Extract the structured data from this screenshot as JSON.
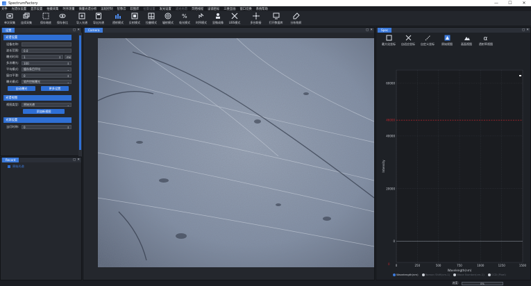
{
  "window": {
    "title": "SpectrumFactory",
    "minimize": "—",
    "maximize": "☐",
    "close": "✕"
  },
  "menu": [
    {
      "label": "文件",
      "dim": false
    },
    {
      "label": "光谱仪设置",
      "dim": false
    },
    {
      "label": "显示设置",
      "dim": false
    },
    {
      "label": "拍摄采集",
      "dim": false
    },
    {
      "label": "时序测量",
      "dim": false
    },
    {
      "label": "微量光谱分析",
      "dim": false
    },
    {
      "label": "运程控制",
      "dim": false
    },
    {
      "label": "智像云",
      "dim": false
    },
    {
      "label": "软图库",
      "dim": false
    },
    {
      "label": "拉曼设置",
      "dim": true
    },
    {
      "label": "发光设置",
      "dim": false
    },
    {
      "label": "滤光光谱",
      "dim": true
    },
    {
      "label": "荧晒线程",
      "dim": false
    },
    {
      "label": "宙铺密标",
      "dim": false
    },
    {
      "label": "三维显画",
      "dim": false
    },
    {
      "label": "窗口切换",
      "dim": false
    },
    {
      "label": "系统帮助",
      "dim": false
    }
  ],
  "toolbar": [
    {
      "label": "单次采集",
      "icon": "single-capture-icon",
      "wide": false
    },
    {
      "label": "连续采集",
      "icon": "continuous-capture-icon",
      "wide": false
    },
    {
      "sep": true
    },
    {
      "label": "保存暗底",
      "icon": "save-dark-icon",
      "wide": false
    },
    {
      "label": "保存参比",
      "icon": "save-reference-icon",
      "wide": false
    },
    {
      "sep": true
    },
    {
      "label": "导入光谱",
      "icon": "import-spectrum-icon",
      "wide": false
    },
    {
      "label": "导出光谱",
      "icon": "export-spectrum-icon",
      "wide": false
    },
    {
      "sep": true
    },
    {
      "label": "透射模式",
      "icon": "transmission-mode-icon",
      "wide": false
    },
    {
      "label": "反射模式",
      "icon": "reflection-mode-icon",
      "wide": false
    },
    {
      "label": "拉曼模式",
      "icon": "raman-mode-icon",
      "wide": false
    },
    {
      "label": "辐射模式",
      "icon": "radiation-mode-icon",
      "wide": false
    },
    {
      "label": "吸光模式",
      "icon": "absorbance-mode-icon",
      "wide": false
    },
    {
      "label": "时序模式",
      "icon": "timing-mode-icon",
      "wide": false
    },
    {
      "label": "显微成像",
      "icon": "microscope-imaging-icon",
      "wide": false
    },
    {
      "label": "LIBS模式",
      "icon": "libs-mode-icon",
      "wide": false
    },
    {
      "sep": true
    },
    {
      "label": "多台联接",
      "icon": "multi-device-icon",
      "wide": true
    },
    {
      "label": "打开数据库",
      "icon": "open-database-icon",
      "wide": true
    },
    {
      "label": "分析物质",
      "icon": "analyze-substance-icon",
      "wide": true
    }
  ],
  "left_panel": {
    "tab": "设置",
    "section_spectro": "光谱设置",
    "fields": [
      {
        "label": "设备名称:",
        "value": "",
        "arrow": ""
      },
      {
        "label": "波长范围:",
        "value": "0.0",
        "arrow": ""
      },
      {
        "label": "曝光时间:",
        "value": "1",
        "arrow": "⇕",
        "unit": "ms"
      },
      {
        "label": "多次曝光:",
        "value": "100",
        "arrow": "⇕"
      },
      {
        "label": "平均模式:",
        "value": "缓存条目平均",
        "arrow": "⌄"
      },
      {
        "label": "窗口平滑:",
        "value": "0",
        "arrow": "⇕"
      },
      {
        "label": "曝光模式:",
        "value": "软件控制曝光",
        "arrow": "⌄"
      }
    ],
    "btn_auto": "自动曝光",
    "btn_more": "更多设置",
    "section_view": "光谱视图",
    "view_type_label": "视图类型:",
    "view_type_value": "原始光谱",
    "btn_add_view": "添加新视图",
    "section_light": "光源设置",
    "light_label": "当灯时称:",
    "light_value": "0"
  },
  "record_panel": {
    "tab": "Record",
    "item": "原始光谱"
  },
  "camera_panel": {
    "tab": "Camera"
  },
  "spec_panel": {
    "tab": "Spec",
    "tools": [
      {
        "label": "最大化坐标",
        "icon": "maximize-coords-icon"
      },
      {
        "label": "自适应坐标",
        "icon": "auto-fit-coords-icon"
      },
      {
        "label": "自定义坐标",
        "icon": "custom-coords-icon"
      },
      {
        "label": "原始视图",
        "icon": "raw-view-icon"
      },
      {
        "label": "画面视图",
        "icon": "image-view-icon"
      },
      {
        "label": "透射率视图",
        "icon": "alpha-view-icon"
      }
    ],
    "legend": [
      {
        "label": "Wavelength(nm)",
        "active": true
      },
      {
        "label": "Raman Shift(cm-1)",
        "active": false
      },
      {
        "label": "Wave Number(cm-1)",
        "active": false
      },
      {
        "label": "CCD (Pixel)",
        "active": false
      }
    ]
  },
  "chart_data": {
    "type": "line",
    "title": "",
    "xlabel": "Wavelength(nm)",
    "ylabel": "Intensity",
    "xlim": [
      0,
      1500
    ],
    "ylim": [
      -8000,
      65000
    ],
    "xticks": [
      0,
      250,
      500,
      750,
      1000,
      1250,
      1500
    ],
    "yticks": [
      0,
      20000,
      40000,
      60000
    ],
    "xtick_labels": [
      "0",
      "250",
      "500",
      "750",
      "1000",
      "1250",
      "1500"
    ],
    "ytick_labels": [
      "0",
      "20000",
      "40000",
      "60000"
    ],
    "grid": true,
    "series": [
      {
        "values": [
          [
            0,
            46000
          ],
          [
            1500,
            46000
          ]
        ],
        "color": "#c0242c"
      }
    ],
    "marker_label": "46000",
    "bottom_marker": "0"
  },
  "status": {
    "progress_label": "进度:",
    "progress_value": "0%",
    "progress": 0
  }
}
